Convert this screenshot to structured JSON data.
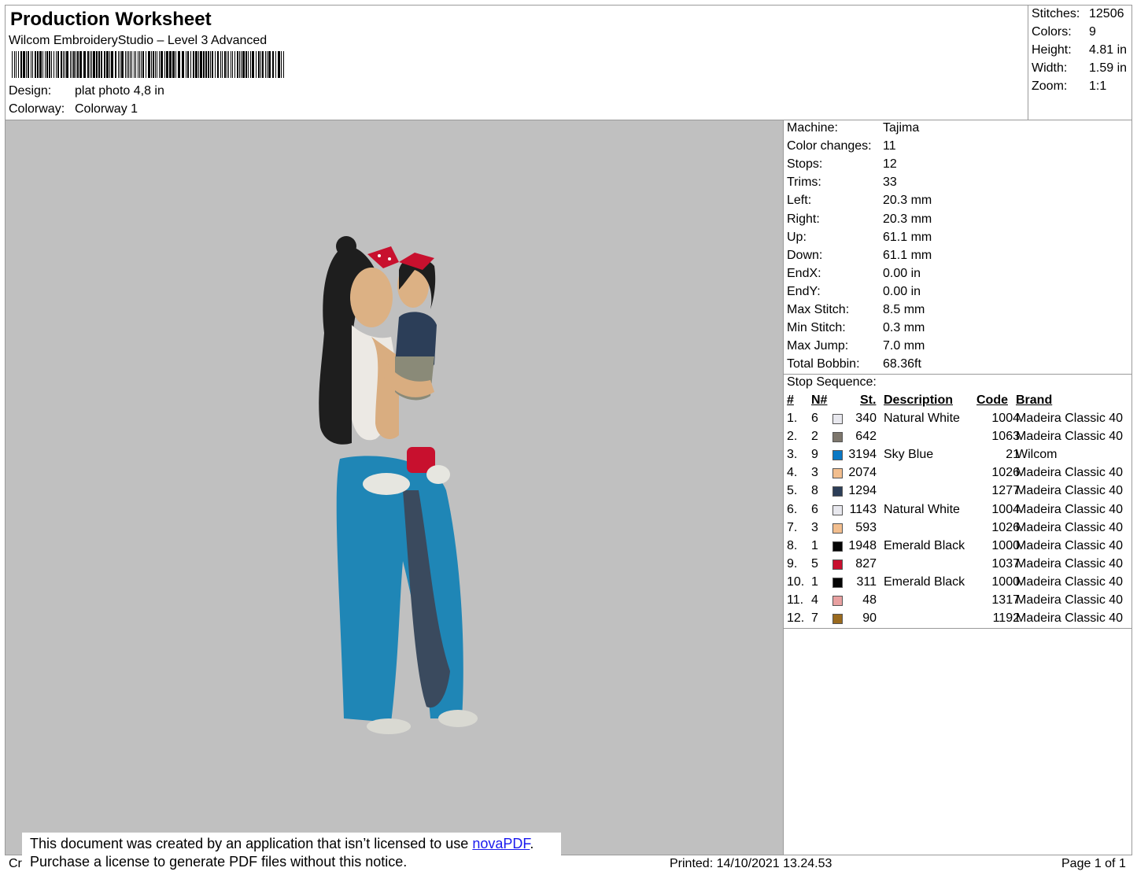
{
  "header": {
    "title": "Production Worksheet",
    "software": "Wilcom EmbroideryStudio – Level 3 Advanced",
    "design_label": "Design:",
    "design_value": "plat photo 4,8 in",
    "colorway_label": "Colorway:",
    "colorway_value": "Colorway 1"
  },
  "stats": [
    {
      "label": "Stitches:",
      "value": "12506"
    },
    {
      "label": "Colors:",
      "value": "9"
    },
    {
      "label": "Height:",
      "value": "4.81 in"
    },
    {
      "label": "Width:",
      "value": "1.59 in"
    },
    {
      "label": "Zoom:",
      "value": "1:1"
    }
  ],
  "machine_info": [
    {
      "label": "Machine:",
      "value": "Tajima"
    },
    {
      "label": "Color changes:",
      "value": "11"
    },
    {
      "label": "Stops:",
      "value": "12"
    },
    {
      "label": "Trims:",
      "value": "33"
    },
    {
      "label": "Left:",
      "value": "20.3 mm"
    },
    {
      "label": "Right:",
      "value": "20.3 mm"
    },
    {
      "label": "Up:",
      "value": "61.1 mm"
    },
    {
      "label": "Down:",
      "value": "61.1 mm"
    },
    {
      "label": "EndX:",
      "value": "0.00 in"
    },
    {
      "label": "EndY:",
      "value": "0.00 in"
    },
    {
      "label": "Max Stitch:",
      "value": "8.5 mm"
    },
    {
      "label": "Min Stitch:",
      "value": "0.3 mm"
    },
    {
      "label": "Max Jump:",
      "value": "7.0 mm"
    },
    {
      "label": "Total Bobbin:",
      "value": "68.36ft"
    }
  ],
  "stop_sequence": {
    "label": "Stop Sequence:",
    "headers": {
      "num": "#",
      "n": "N#",
      "st": "St.",
      "desc": "Description",
      "code": "Code",
      "brand": "Brand"
    },
    "rows": [
      {
        "num": "1.",
        "n": "6",
        "color": "#e8e8ee",
        "st": "340",
        "desc": "Natural White",
        "code": "1004",
        "brand": "Madeira Classic 40"
      },
      {
        "num": "2.",
        "n": "2",
        "color": "#7d766c",
        "st": "642",
        "desc": "",
        "code": "1063",
        "brand": "Madeira Classic 40"
      },
      {
        "num": "3.",
        "n": "9",
        "color": "#0a78c4",
        "st": "3194",
        "desc": "Sky Blue",
        "code": "21",
        "brand": "Wilcom"
      },
      {
        "num": "4.",
        "n": "3",
        "color": "#f2be8e",
        "st": "2074",
        "desc": "",
        "code": "1026",
        "brand": "Madeira Classic 40"
      },
      {
        "num": "5.",
        "n": "8",
        "color": "#2c3e58",
        "st": "1294",
        "desc": "",
        "code": "1277",
        "brand": "Madeira Classic 40"
      },
      {
        "num": "6.",
        "n": "6",
        "color": "#e8e8ee",
        "st": "1143",
        "desc": "Natural White",
        "code": "1004",
        "brand": "Madeira Classic 40"
      },
      {
        "num": "7.",
        "n": "3",
        "color": "#f2be8e",
        "st": "593",
        "desc": "",
        "code": "1026",
        "brand": "Madeira Classic 40"
      },
      {
        "num": "8.",
        "n": "1",
        "color": "#050505",
        "st": "1948",
        "desc": "Emerald Black",
        "code": "1000",
        "brand": "Madeira Classic 40"
      },
      {
        "num": "9.",
        "n": "5",
        "color": "#c8102e",
        "st": "827",
        "desc": "",
        "code": "1037",
        "brand": "Madeira Classic 40"
      },
      {
        "num": "10.",
        "n": "1",
        "color": "#050505",
        "st": "311",
        "desc": "Emerald Black",
        "code": "1000",
        "brand": "Madeira Classic 40"
      },
      {
        "num": "11.",
        "n": "4",
        "color": "#e8a0a0",
        "st": "48",
        "desc": "",
        "code": "1317",
        "brand": "Madeira Classic 40"
      },
      {
        "num": "12.",
        "n": "7",
        "color": "#9a6a1e",
        "st": "90",
        "desc": "",
        "code": "1192",
        "brand": "Madeira Classic 40"
      }
    ]
  },
  "footer": {
    "left": "Cr",
    "printed": "Printed: 14/10/2021 13.24.53",
    "page": "Page 1 of 1"
  },
  "notice": {
    "line1_pre": "This document was created by an application that isn’t licensed to use ",
    "link": "novaPDF",
    "line1_post": ".",
    "line2": "Purchase a license to generate PDF files without this notice."
  }
}
